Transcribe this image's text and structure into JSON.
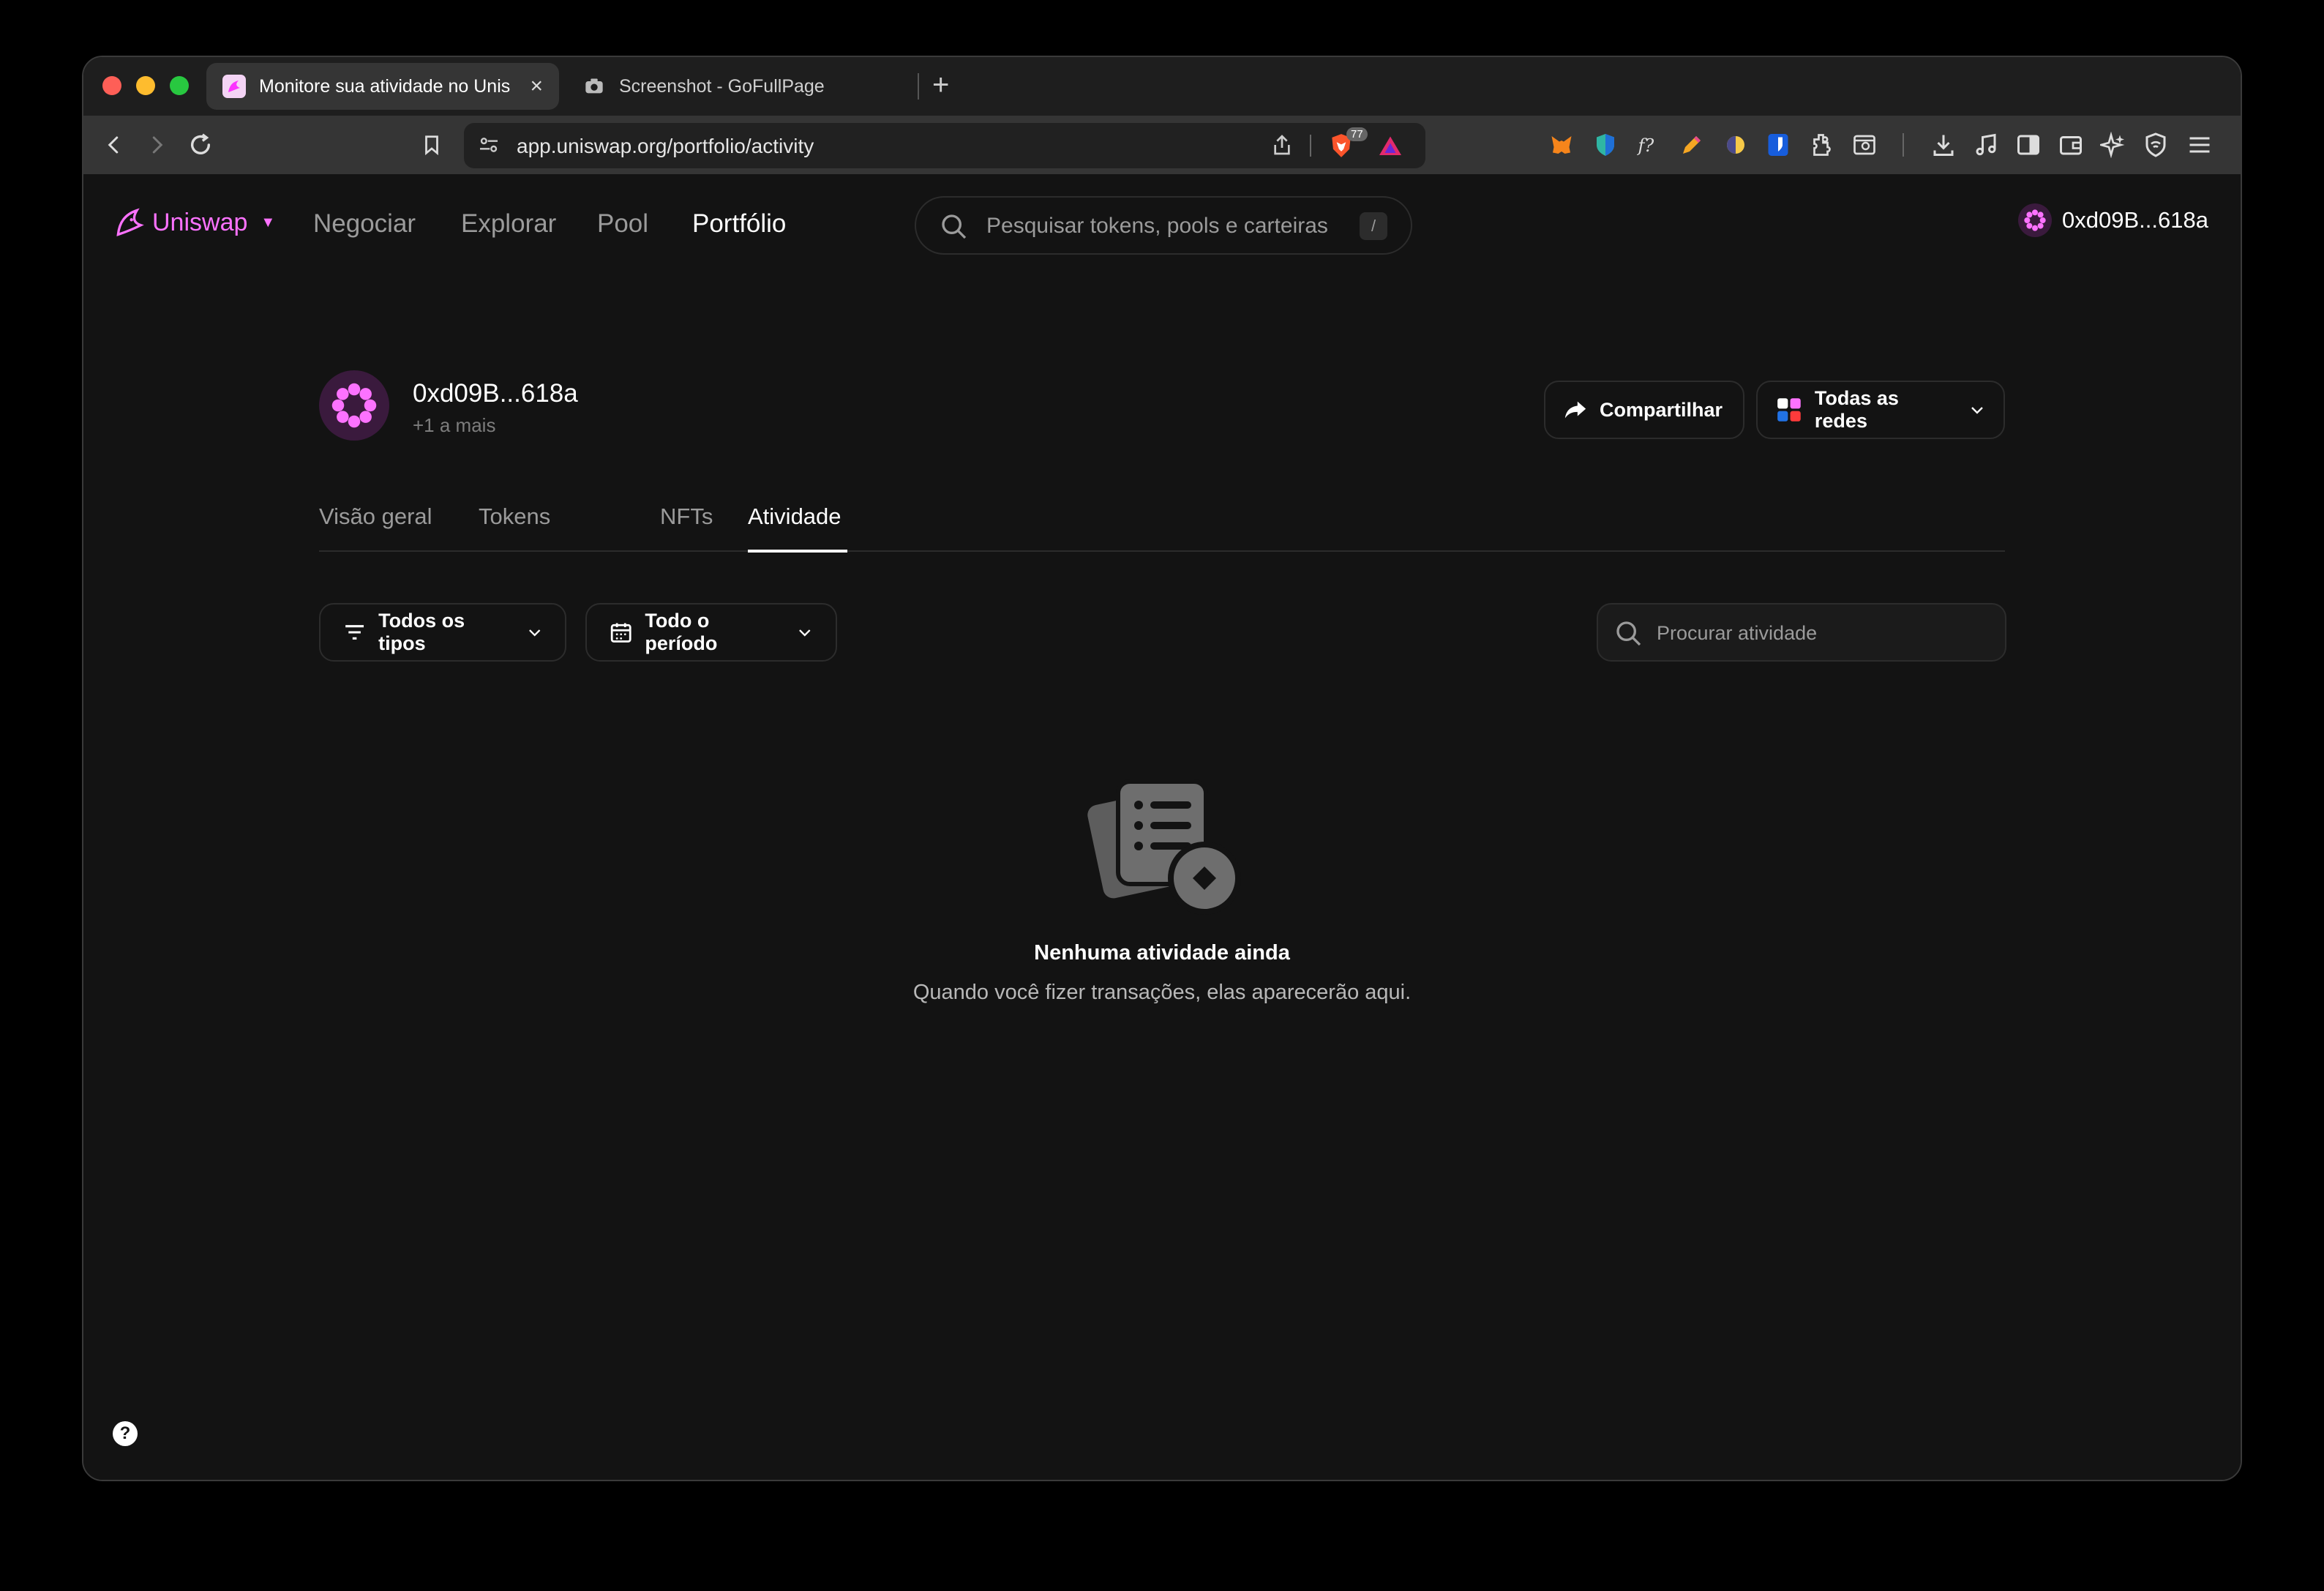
{
  "browser": {
    "tabs": [
      {
        "title": "Monitore sua atividade no Unis",
        "active": true
      },
      {
        "title": "Screenshot - GoFullPage",
        "active": false
      }
    ],
    "new_tab": "+",
    "close": "×",
    "url": "app.uniswap.org/portfolio/activity",
    "brave_badge": "77"
  },
  "app": {
    "brand": "Uniswap",
    "brand_color": "#fc72ff",
    "nav": [
      "Negociar",
      "Explorar",
      "Pool",
      "Portfólio"
    ],
    "search_placeholder": "Pesquisar tokens, pools e carteiras",
    "search_shortcut": "/",
    "account": "0xd09B...618a"
  },
  "profile": {
    "address": "0xd09B...618a",
    "subtitle": "+1 a mais",
    "share_label": "Compartilhar",
    "networks_label": "Todas as redes"
  },
  "portfolio_tabs": [
    "Visão geral",
    "Tokens",
    "NFTs",
    "Atividade"
  ],
  "filters": {
    "types": "Todos os tipos",
    "period": "Todo o período",
    "search_placeholder": "Procurar atividade"
  },
  "empty": {
    "title": "Nenhuma atividade ainda",
    "subtitle": "Quando você fizer transações, elas aparecerão aqui."
  },
  "help": "?"
}
